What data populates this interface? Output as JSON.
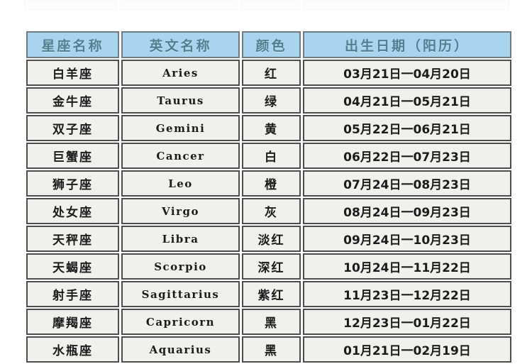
{
  "ghost_row": {
    "cells": [
      "",
      "",
      "",
      ""
    ]
  },
  "table": {
    "headers": {
      "name": "星座名称",
      "english": "英文名称",
      "color": "颜色",
      "birthdate": "出生日期（阳历）"
    },
    "header_bg": "#a8d4f0",
    "header_text_color": "#4f7f91",
    "cell_bg": "#f1f0ed",
    "border_color": "#4d4d4d",
    "rows": [
      {
        "name": "白羊座",
        "english": "Aries",
        "color": "红",
        "birthdate": "03月21日一04月20日"
      },
      {
        "name": "金牛座",
        "english": "Taurus",
        "color": "绿",
        "birthdate": "04月21日一05月21日"
      },
      {
        "name": "双子座",
        "english": "Gemini",
        "color": "黄",
        "birthdate": "05月22日一06月21日"
      },
      {
        "name": "巨蟹座",
        "english": "Cancer",
        "color": "白",
        "birthdate": "06月22日一07月23日"
      },
      {
        "name": "狮子座",
        "english": "Leo",
        "color": "橙",
        "birthdate": "07月24日一08月23日"
      },
      {
        "name": "处女座",
        "english": "Virgo",
        "color": "灰",
        "birthdate": "08月24日一09月23日"
      },
      {
        "name": "天秤座",
        "english": "Libra",
        "color": "淡红",
        "birthdate": "09月24日一10月23日"
      },
      {
        "name": "天蝎座",
        "english": "Scorpio",
        "color": "深红",
        "birthdate": "10月24日一11月22日"
      },
      {
        "name": "射手座",
        "english": "Sagittarius",
        "color": "紫红",
        "birthdate": "11月23日一12月22日"
      },
      {
        "name": "摩羯座",
        "english": "Capricorn",
        "color": "黑",
        "birthdate": "12月23日一01月22日"
      },
      {
        "name": "水瓶座",
        "english": "Aquarius",
        "color": "黑",
        "birthdate": "01月21日一02月19日"
      }
    ]
  }
}
